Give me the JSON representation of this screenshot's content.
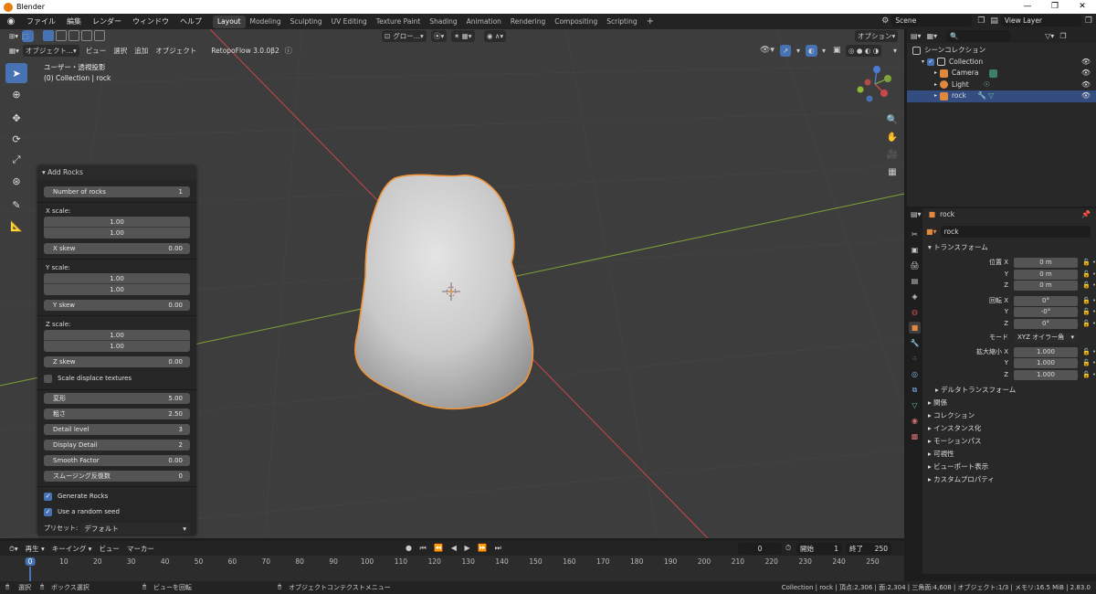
{
  "window": {
    "title": "Blender",
    "controls": [
      "—",
      "❐",
      "✕"
    ]
  },
  "topmenu": {
    "menus": [
      "ファイル",
      "編集",
      "レンダー",
      "ウィンドウ",
      "ヘルプ"
    ],
    "workspaces": [
      "Layout",
      "Modeling",
      "Sculpting",
      "UV Editing",
      "Texture Paint",
      "Shading",
      "Animation",
      "Rendering",
      "Compositing",
      "Scripting"
    ],
    "active_workspace": "Layout",
    "scene": "Scene",
    "view_layer": "View Layer"
  },
  "viewport_header": {
    "mode": "オブジェクト...",
    "menus": [
      "ビュー",
      "選択",
      "追加",
      "オブジェクト"
    ],
    "addon": "RetopoFlow 3.0.0β2",
    "transform_orientation": "グロー...",
    "options": "オプション"
  },
  "viewport": {
    "view_name": "ユーザー・透視投影",
    "collection_info": "(0) Collection | rock"
  },
  "redo_panel": {
    "title": "Add Rocks",
    "number_of_rocks": {
      "label": "Number of rocks",
      "value": "1"
    },
    "x_scale": {
      "label": "X scale:",
      "min": "1.00",
      "max": "1.00"
    },
    "x_skew": {
      "label": "X skew",
      "value": "0.00"
    },
    "y_scale": {
      "label": "Y scale:",
      "min": "1.00",
      "max": "1.00"
    },
    "y_skew": {
      "label": "Y skew",
      "value": "0.00"
    },
    "z_scale": {
      "label": "Z scale:",
      "min": "1.00",
      "max": "1.00"
    },
    "z_skew": {
      "label": "Z skew",
      "value": "0.00"
    },
    "scale_displace": {
      "label": "Scale displace textures",
      "checked": false
    },
    "deform": {
      "label": "変形",
      "value": "5.00"
    },
    "rough": {
      "label": "粗さ",
      "value": "2.50"
    },
    "detail_level": {
      "label": "Detail level",
      "value": "3"
    },
    "display_detail": {
      "label": "Display Detail",
      "value": "2"
    },
    "smooth_factor": {
      "label": "Smooth Factor",
      "value": "0.00"
    },
    "smooth_iterations": {
      "label": "スムージング反復数",
      "value": "0"
    },
    "generate_rocks": {
      "label": "Generate Rocks",
      "checked": true
    },
    "random_seed": {
      "label": "Use a random seed",
      "checked": true
    },
    "preset": {
      "label": "プリセット:",
      "value": "デフォルト"
    }
  },
  "outliner": {
    "root": "シーンコレクション",
    "items": [
      {
        "name": "Collection"
      },
      {
        "name": "Camera"
      },
      {
        "name": "Light"
      },
      {
        "name": "rock"
      }
    ]
  },
  "properties": {
    "object_name": "rock",
    "data_name": "rock",
    "transform_title": "トランスフォーム",
    "location": {
      "label": "位置 X",
      "x": "0 m",
      "y": "0 m",
      "z": "0 m"
    },
    "rotation": {
      "label": "回転 X",
      "x": "0°",
      "y": "-0°",
      "z": "0°"
    },
    "mode": {
      "label": "モード",
      "value": "XYZ オイラー角"
    },
    "scale": {
      "label": "拡大縮小 X",
      "x": "1.000",
      "y": "1.000",
      "z": "1.000"
    },
    "axis_y": "Y",
    "axis_z": "Z",
    "delta_transform": "デルタトランスフォーム",
    "sections": [
      "関係",
      "コレクション",
      "インスタンス化",
      "モーションパス",
      "可視性",
      "ビューポート表示",
      "カスタムプロパティ"
    ]
  },
  "timeline": {
    "menus": [
      "再生",
      "キーイング",
      "ビュー",
      "マーカー"
    ],
    "current_frame": "0",
    "start_label": "開始",
    "start": "1",
    "end_label": "終了",
    "end": "250",
    "ticks": [
      "0",
      "10",
      "20",
      "30",
      "40",
      "50",
      "60",
      "70",
      "80",
      "90",
      "100",
      "110",
      "120",
      "130",
      "140",
      "150",
      "160",
      "170",
      "180",
      "190",
      "200",
      "210",
      "220",
      "230",
      "240",
      "250"
    ]
  },
  "statusbar": {
    "select": "選択",
    "box_select": "ボックス選択",
    "rotate_view": "ビューを回転",
    "context_menu": "オブジェクトコンテクストメニュー",
    "stats": "Collection | rock | 頂点:2,306 | 面:2,304 | 三角面:4,608 | オブジェクト:1/3 | メモリ:16.5 MiB | 2.83.0"
  },
  "colors": {
    "accent": "#4772b3",
    "selection_outline": "#f0953a",
    "x_axis": "#c8484d",
    "y_axis": "#7fa338"
  }
}
